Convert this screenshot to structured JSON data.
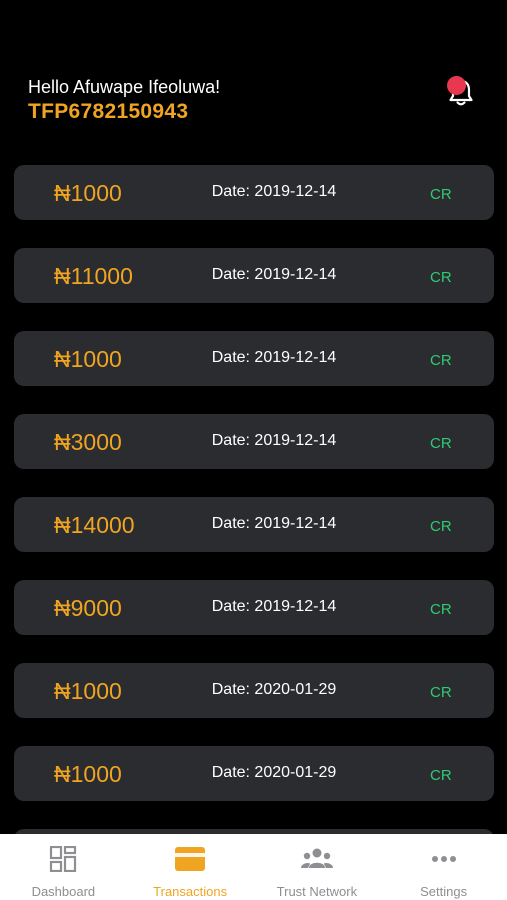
{
  "header": {
    "greeting": "Hello Afuwape Ifeoluwa!",
    "account_id": "TFP6782150943"
  },
  "notifications": {
    "icon": "bell-icon",
    "has_unread": true,
    "badge_color": "#e8384f"
  },
  "transactions": [
    {
      "amount": "₦1000",
      "date": "Date: 2019-12-14",
      "type": "CR"
    },
    {
      "amount": "₦11000",
      "date": "Date: 2019-12-14",
      "type": "CR"
    },
    {
      "amount": "₦1000",
      "date": "Date: 2019-12-14",
      "type": "CR"
    },
    {
      "amount": "₦3000",
      "date": "Date: 2019-12-14",
      "type": "CR"
    },
    {
      "amount": "₦14000",
      "date": "Date: 2019-12-14",
      "type": "CR"
    },
    {
      "amount": "₦9000",
      "date": "Date: 2019-12-14",
      "type": "CR"
    },
    {
      "amount": "₦1000",
      "date": "Date: 2020-01-29",
      "type": "CR"
    },
    {
      "amount": "₦1000",
      "date": "Date: 2020-01-29",
      "type": "CR"
    },
    {
      "amount": "",
      "date": "",
      "type": ""
    }
  ],
  "tabbar": {
    "active": "transactions",
    "tabs": [
      {
        "id": "dashboard",
        "label": "Dashboard",
        "icon": "dashboard-icon"
      },
      {
        "id": "transactions",
        "label": "Transactions",
        "icon": "card-icon"
      },
      {
        "id": "trust_network",
        "label": "Trust Network",
        "icon": "people-icon"
      },
      {
        "id": "settings",
        "label": "Settings",
        "icon": "more-icon"
      }
    ]
  },
  "colors": {
    "accent": "#f0a522",
    "credit": "#2ecc71",
    "background": "#000000",
    "card": "#2b2c2f",
    "inactive_tab": "#8e8e93"
  }
}
